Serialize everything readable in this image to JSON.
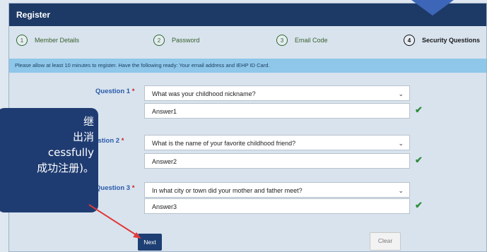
{
  "header": {
    "title": "Register"
  },
  "steps": [
    {
      "num": "1",
      "label": "Member Details"
    },
    {
      "num": "2",
      "label": "Password"
    },
    {
      "num": "3",
      "label": "Email Code"
    },
    {
      "num": "4",
      "label": "Security Questions"
    }
  ],
  "notice": "Please allow at least 10 minutes to register. Have the following ready: Your email address and IEHP ID Card.",
  "questions": [
    {
      "label": "Question 1",
      "required": "*",
      "selected": "What was your childhood nickname?",
      "answer": "Answer1"
    },
    {
      "label": "Question 2",
      "required": "*",
      "selected": "What is the name of your favorite childhood friend?",
      "answer": "Answer2"
    },
    {
      "label": "Question 3",
      "required": "*",
      "selected": "In what city or town did your mother and father meet?",
      "answer": "Answer3"
    }
  ],
  "buttons": {
    "next": "Next",
    "clear": "Clear"
  },
  "tooltip": {
    "line1": "继",
    "line2": "出消",
    "line3": "cessfully",
    "line4": "成功注册)。"
  },
  "colors": {
    "header": "#1d3a66",
    "notice": "#8ec7ea",
    "next": "#1d3f73",
    "arrow": "#e03a3a",
    "check": "#2e8b3a"
  }
}
